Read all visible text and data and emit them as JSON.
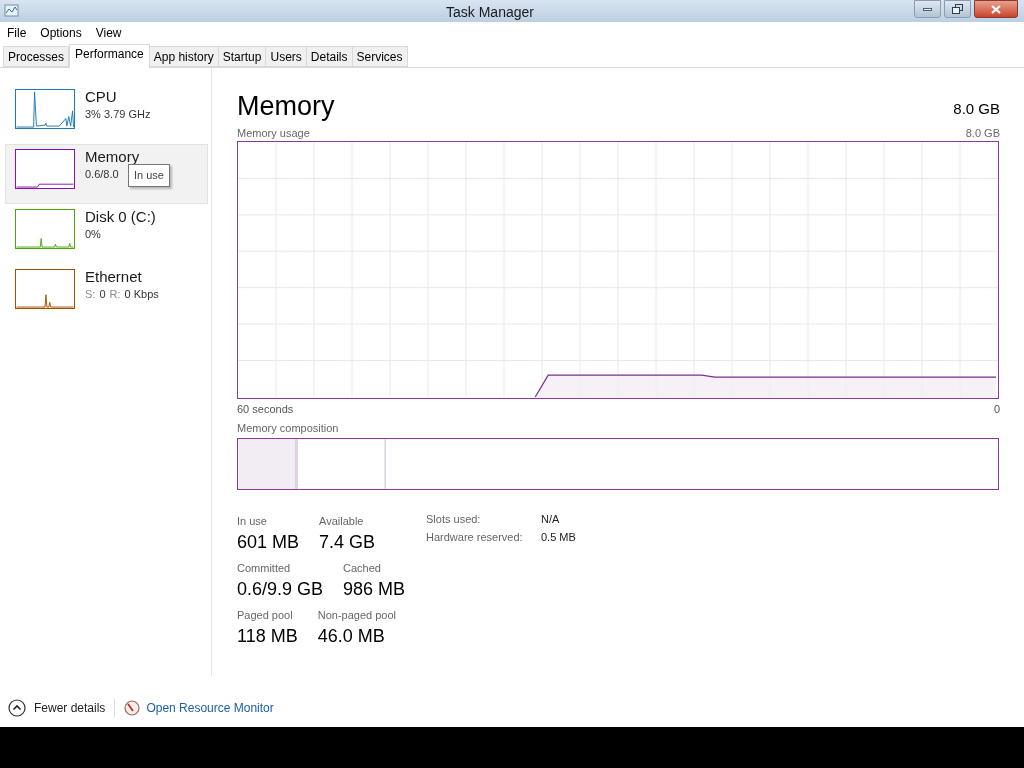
{
  "window": {
    "title": "Task Manager"
  },
  "menu": [
    "File",
    "Options",
    "View"
  ],
  "tabs": [
    {
      "label": "Processes",
      "selected": false
    },
    {
      "label": "Performance",
      "selected": true
    },
    {
      "label": "App history",
      "selected": false
    },
    {
      "label": "Startup",
      "selected": false
    },
    {
      "label": "Users",
      "selected": false
    },
    {
      "label": "Details",
      "selected": false
    },
    {
      "label": "Services",
      "selected": false
    }
  ],
  "sidebar": {
    "items": [
      {
        "name": "CPU",
        "detail": [
          {
            "text": "3% 3.79 GHz",
            "muted": false
          }
        ],
        "color": "#1b7bb3",
        "selected": false
      },
      {
        "name": "Memory",
        "detail": [
          {
            "text": "0.6/8.0",
            "muted": false
          }
        ],
        "color": "#8b12ae",
        "selected": true
      },
      {
        "name": "Disk 0 (C:)",
        "detail": [
          {
            "text": "0%",
            "muted": false
          }
        ],
        "color": "#4da60c",
        "selected": false
      },
      {
        "name": "Ethernet",
        "detail": [
          {
            "text": "S:",
            "muted": true
          },
          {
            "text": "0",
            "muted": false
          },
          {
            "text": "R:",
            "muted": true
          },
          {
            "text": "0 Kbps",
            "muted": false
          }
        ],
        "color": "#a74f01",
        "selected": false
      }
    ]
  },
  "tooltip": "In use",
  "main": {
    "title": "Memory",
    "total": "8.0 GB",
    "graph_label": "Memory usage",
    "graph_max": "8.0 GB",
    "x_start": "60 seconds",
    "x_end": "0",
    "composition_label": "Memory composition",
    "stat_rows": [
      [
        {
          "label": "In use",
          "value": "601 MB"
        },
        {
          "label": "Available",
          "value": "7.4 GB"
        }
      ],
      [
        {
          "label": "Committed",
          "value": "0.6/9.9 GB"
        },
        {
          "label": "Cached",
          "value": "986 MB"
        }
      ],
      [
        {
          "label": "Paged pool",
          "value": "118 MB"
        },
        {
          "label": "Non-paged pool",
          "value": "46.0 MB"
        }
      ]
    ],
    "details": [
      {
        "label": "Slots used:",
        "value": "N/A"
      },
      {
        "label": "Hardware reserved:",
        "value": "0.5 MB"
      }
    ]
  },
  "footer": {
    "fewer_details": "Fewer details",
    "resource_monitor": "Open Resource Monitor"
  }
}
